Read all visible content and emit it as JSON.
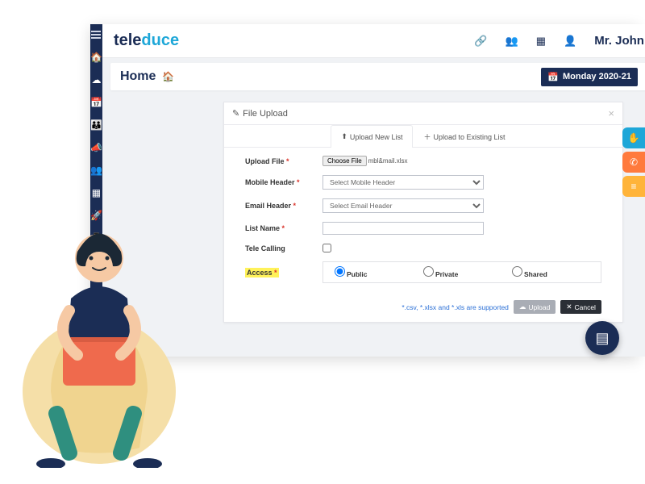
{
  "brand": {
    "part1": "tele",
    "part2": "duce"
  },
  "topbar": {
    "user": "Mr. John"
  },
  "breadcrumb": {
    "title": "Home"
  },
  "date_badge": "Monday 2020-21",
  "panel": {
    "title": "File Upload",
    "tabs": {
      "new": "Upload New List",
      "existing": "Upload to Existing List"
    }
  },
  "form": {
    "upload_file_label": "Upload File",
    "choose_file_btn": "Choose File",
    "chosen_file": "mbl&mail.xlsx",
    "mobile_header_label": "Mobile Header",
    "mobile_header_placeholder": "Select Mobile Header",
    "email_header_label": "Email Header",
    "email_header_placeholder": "Select Email Header",
    "list_name_label": "List Name",
    "tele_calling_label": "Tele Calling",
    "access_label": "Access",
    "access_options": {
      "public": "Public",
      "private": "Private",
      "shared": "Shared"
    },
    "hint": "*.csv, *.xlsx and *.xls are supported",
    "upload_btn": "Upload",
    "cancel_btn": "Cancel"
  }
}
